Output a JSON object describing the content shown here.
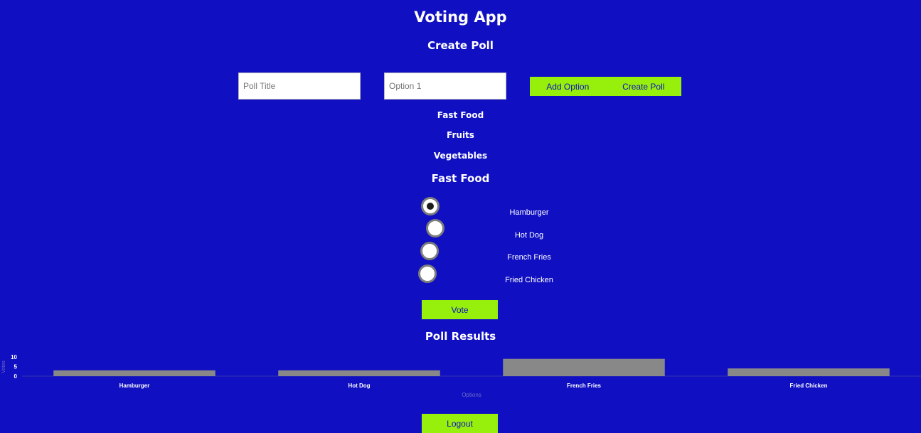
{
  "app": {
    "title": "Voting App"
  },
  "create_poll": {
    "heading": "Create Poll",
    "poll_title_placeholder": "Poll Title",
    "option_placeholder": "Option 1",
    "add_option_label": "Add Option",
    "create_poll_label": "Create Poll"
  },
  "polls": [
    {
      "title": "Fast Food"
    },
    {
      "title": "Fruits"
    },
    {
      "title": "Vegetables"
    }
  ],
  "current_poll": {
    "title": "Fast Food",
    "selected_option": "Hamburger",
    "options": [
      {
        "label": "Hamburger",
        "checked": true
      },
      {
        "label": "Hot Dog",
        "checked": false
      },
      {
        "label": "French Fries",
        "checked": false
      },
      {
        "label": "Fried Chicken",
        "checked": false
      }
    ],
    "vote_label": "Vote"
  },
  "results": {
    "heading": "Poll Results"
  },
  "chart_data": {
    "type": "bar",
    "categories": [
      "Hamburger",
      "Hot Dog",
      "French Fries",
      "Fried Chicken"
    ],
    "values": [
      3,
      3,
      9,
      4
    ],
    "ylabel": "Votes",
    "xlabel": "Options",
    "yticks": [
      0,
      5,
      10
    ],
    "ylim": [
      0,
      10
    ],
    "bar_color": "#888888",
    "grid": false,
    "legend": false
  },
  "footer": {
    "logout_label": "Logout"
  },
  "colors": {
    "background": "#1010c2",
    "accent": "#96f00c",
    "text": "#ffffff",
    "button_text": "#1010c2"
  }
}
